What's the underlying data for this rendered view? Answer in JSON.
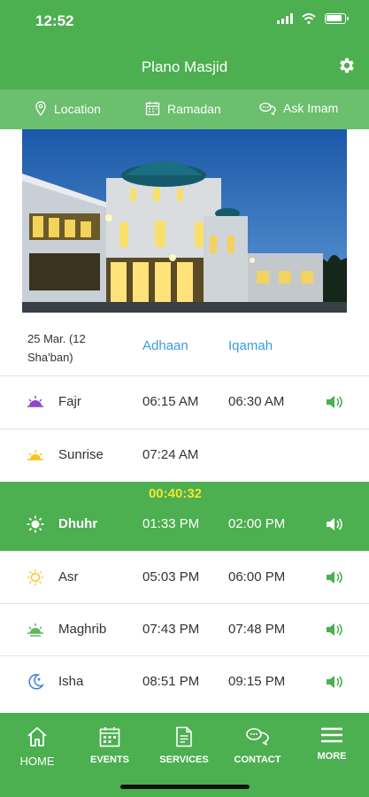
{
  "status_bar": {
    "time": "12:52"
  },
  "header": {
    "title": "Plano Masjid",
    "settings_icon": "gear-icon"
  },
  "subnav": [
    {
      "label": "Location",
      "icon": "location-pin-icon"
    },
    {
      "label": "Ramadan",
      "icon": "calendar-icon"
    },
    {
      "label": "Ask Imam",
      "icon": "chat-bubbles-icon"
    }
  ],
  "schedule": {
    "date": "25 Mar. (12 Sha'ban)",
    "adhaan_label": "Adhaan",
    "iqamah_label": "Iqamah"
  },
  "prayers": [
    {
      "name": "Fajr",
      "adhaan": "06:15 AM",
      "iqamah": "06:30 AM",
      "icon": "dawn-icon"
    },
    {
      "name": "Sunrise",
      "adhaan": "07:24 AM",
      "iqamah": "",
      "icon": "sunrise-icon"
    },
    {
      "name": "Dhuhr",
      "adhaan": "01:33 PM",
      "iqamah": "02:00 PM",
      "icon": "sun-icon",
      "countdown": "00:40:32"
    },
    {
      "name": "Asr",
      "adhaan": "05:03 PM",
      "iqamah": "06:00 PM",
      "icon": "afternoon-sun-icon"
    },
    {
      "name": "Maghrib",
      "adhaan": "07:43 PM",
      "iqamah": "07:48 PM",
      "icon": "sunset-icon"
    },
    {
      "name": "Isha",
      "adhaan": "08:51 PM",
      "iqamah": "09:15 PM",
      "icon": "moon-icon"
    }
  ],
  "tabs": [
    {
      "label": "HOME",
      "icon": "home-icon"
    },
    {
      "label": "EVENTS",
      "icon": "calendar-icon"
    },
    {
      "label": "SERVICES",
      "icon": "document-icon"
    },
    {
      "label": "CONTACT",
      "icon": "chat-bubbles-icon"
    },
    {
      "label": "MORE",
      "icon": "menu-icon"
    }
  ],
  "colors": {
    "primary": "#4caf50",
    "subnav": "#6cbf6e",
    "link": "#3d9be0",
    "countdown": "#f5e52b"
  }
}
